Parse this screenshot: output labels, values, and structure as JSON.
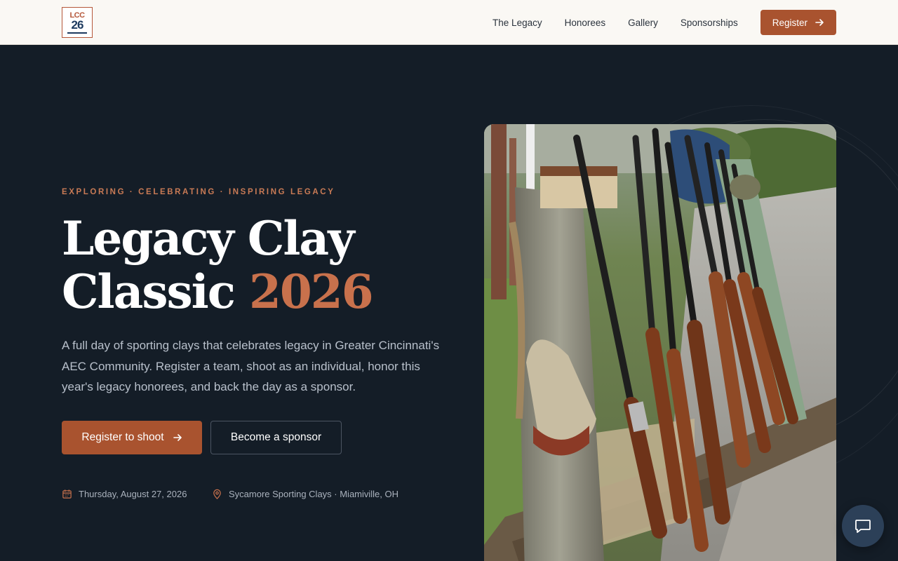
{
  "header": {
    "logo": {
      "line1": "LCC",
      "line2": "26"
    },
    "nav": [
      {
        "label": "The Legacy"
      },
      {
        "label": "Honorees"
      },
      {
        "label": "Gallery"
      },
      {
        "label": "Sponsorships"
      }
    ],
    "register_label": "Register"
  },
  "hero": {
    "eyebrow": "EXPLORING · CELEBRATING · INSPIRING LEGACY",
    "title_line1": "Legacy Clay",
    "title_line2": "Classic",
    "title_year": "2026",
    "description": "A full day of sporting clays that celebrates legacy in Greater Cincinnati's AEC Community. Register a team, shoot as an individual, honor this year's legacy honorees, and back the day as a sponsor.",
    "primary_cta": "Register to shoot",
    "secondary_cta": "Become a sponsor",
    "date": "Thursday, August 27, 2026",
    "location": "Sycamore Sporting Clays · Miamiville, OH"
  },
  "colors": {
    "accent": "#a9532f",
    "background": "#141d27",
    "header_bg": "#faf8f4"
  },
  "icons": {
    "arrow": "arrow-right-icon",
    "calendar": "calendar-icon",
    "location": "map-pin-icon",
    "chat": "chat-bubble-icon"
  }
}
